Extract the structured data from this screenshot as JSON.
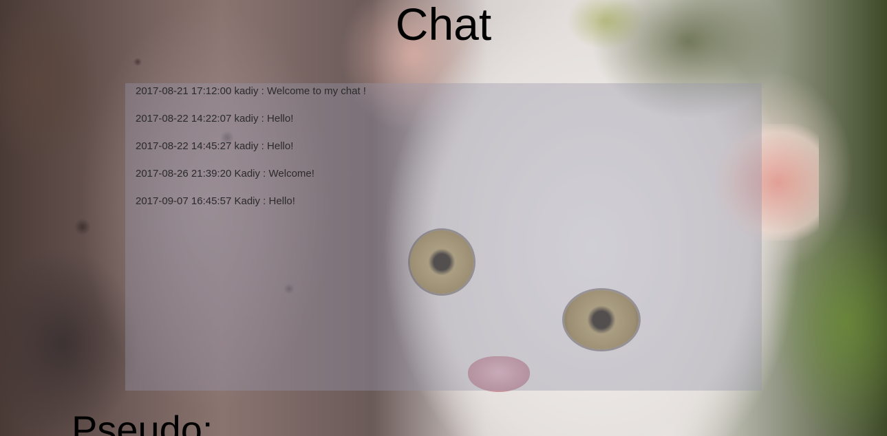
{
  "page": {
    "title": "Chat",
    "pseudo_label": "Pseudo:"
  },
  "messages": [
    {
      "timestamp": "2017-08-21 17:12:00",
      "user": "kadiy",
      "separator": ":",
      "text": "Welcome to my chat !"
    },
    {
      "timestamp": "2017-08-22 14:22:07",
      "user": "kadiy",
      "separator": ":",
      "text": "Hello!"
    },
    {
      "timestamp": "2017-08-22 14:45:27",
      "user": "kadiy",
      "separator": ":",
      "text": "Hello!"
    },
    {
      "timestamp": "2017-08-26 21:39:20",
      "user": "Kadiy",
      "separator": ":",
      "text": "Welcome!"
    },
    {
      "timestamp": "2017-09-07 16:45:57",
      "user": "Kadiy",
      "separator": ":",
      "text": "Hello!"
    }
  ],
  "colors": {
    "title": "#000000",
    "message_text": "#2a2a2a",
    "chat_box_tint": "#9696aa"
  }
}
